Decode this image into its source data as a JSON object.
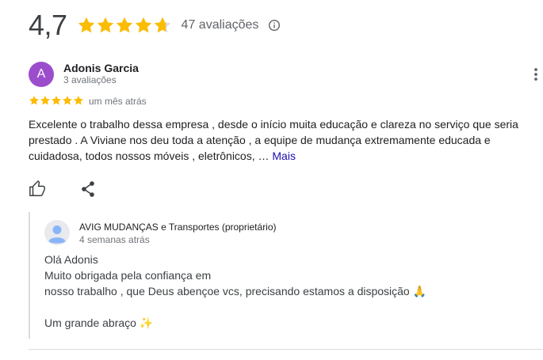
{
  "summary": {
    "rating": "4,7",
    "stars": 4.7,
    "review_count_label": "47 avaliações",
    "info_icon": "info-icon"
  },
  "review": {
    "avatar_letter": "A",
    "avatar_color": "#9c4dcc",
    "reviewer_name": "Adonis Garcia",
    "reviewer_meta": "3 avaliações",
    "stars": 5,
    "date": "um mês atrás",
    "text": "Excelente o trabalho dessa empresa , desde o início muita educação e clareza no serviço que seria prestado . A Viviane nos deu toda a atenção , a equipe de mudança extremamente educada e cuidadosa, todos nossos móveis , eletrônicos, … ",
    "more_label": "Mais",
    "actions": [
      "thumb-up-icon",
      "share-icon"
    ],
    "menu_icon": "more-vert-icon"
  },
  "reply": {
    "owner_name": "AVIG MUDANÇAS e Transportes (proprietário)",
    "date": "4 semanas atrás",
    "lines": [
      "Olá Adonis",
      "Muito obrigada pela confiança em",
      "nosso trabalho , que Deus abençoe vcs, precisando estamos a disposição 🙏",
      "Um grande abraço ✨"
    ]
  },
  "colors": {
    "star": "#fbbc04",
    "star_empty": "#dadce0",
    "link": "#1a0dab",
    "owner_avatar": "#9aa0a6"
  }
}
